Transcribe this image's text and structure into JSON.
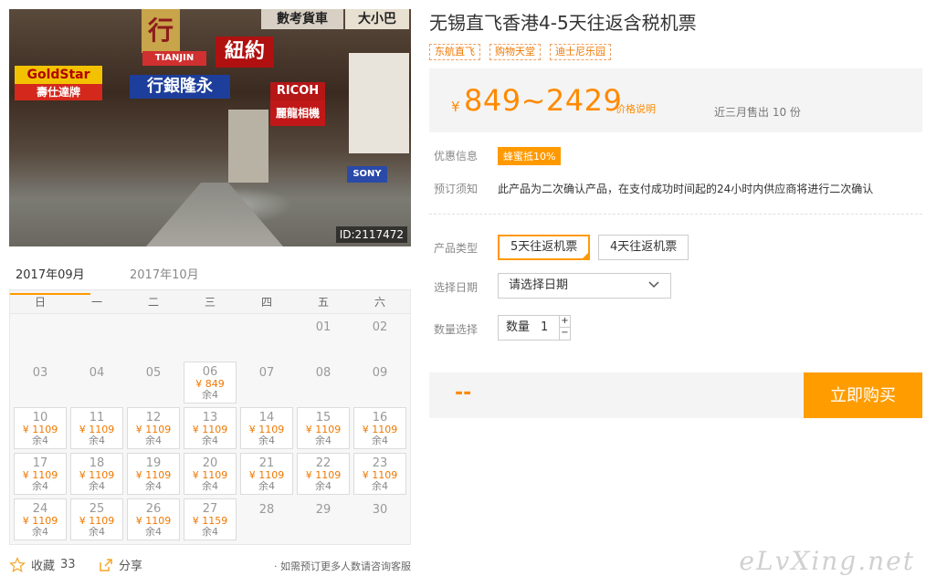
{
  "photo": {
    "id_label": "ID:2117472",
    "signs": [
      "行",
      "數考貨車",
      "大小巴",
      "GoldStar",
      "壽仕達牌",
      "行銀隆永",
      "紐約",
      "RICOH",
      "麗龍相機",
      "TIANJIN",
      "SONY"
    ]
  },
  "calendar": {
    "months": [
      "2017年09月",
      "2017年10月"
    ],
    "weekdays": [
      "日",
      "一",
      "二",
      "三",
      "四",
      "五",
      "六"
    ],
    "days": [
      {
        "d": ""
      },
      {
        "d": ""
      },
      {
        "d": ""
      },
      {
        "d": ""
      },
      {
        "d": ""
      },
      {
        "d": "01"
      },
      {
        "d": "02"
      },
      {
        "d": "03"
      },
      {
        "d": "04"
      },
      {
        "d": "05"
      },
      {
        "d": "06",
        "p": "¥ 849",
        "r": "余4"
      },
      {
        "d": "07"
      },
      {
        "d": "08"
      },
      {
        "d": "09"
      },
      {
        "d": "10",
        "p": "¥ 1109",
        "r": "余4"
      },
      {
        "d": "11",
        "p": "¥ 1109",
        "r": "余4"
      },
      {
        "d": "12",
        "p": "¥ 1109",
        "r": "余4"
      },
      {
        "d": "13",
        "p": "¥ 1109",
        "r": "余4"
      },
      {
        "d": "14",
        "p": "¥ 1109",
        "r": "余4"
      },
      {
        "d": "15",
        "p": "¥ 1109",
        "r": "余4"
      },
      {
        "d": "16",
        "p": "¥ 1109",
        "r": "余4"
      },
      {
        "d": "17",
        "p": "¥ 1109",
        "r": "余4"
      },
      {
        "d": "18",
        "p": "¥ 1109",
        "r": "余4"
      },
      {
        "d": "19",
        "p": "¥ 1109",
        "r": "余4"
      },
      {
        "d": "20",
        "p": "¥ 1109",
        "r": "余4"
      },
      {
        "d": "21",
        "p": "¥ 1109",
        "r": "余4"
      },
      {
        "d": "22",
        "p": "¥ 1109",
        "r": "余4"
      },
      {
        "d": "23",
        "p": "¥ 1109",
        "r": "余4"
      },
      {
        "d": "24",
        "p": "¥ 1109",
        "r": "余4"
      },
      {
        "d": "25",
        "p": "¥ 1109",
        "r": "余4"
      },
      {
        "d": "26",
        "p": "¥ 1109",
        "r": "余4"
      },
      {
        "d": "27",
        "p": "¥ 1159",
        "r": "余4"
      },
      {
        "d": "28"
      },
      {
        "d": "29"
      },
      {
        "d": "30"
      }
    ]
  },
  "footer": {
    "favorite_label": "收藏",
    "favorite_count": "33",
    "share_label": "分享",
    "note": "· 如需预订更多人数请咨询客服"
  },
  "product": {
    "title": "无锡直飞香港4-5天往返含税机票",
    "tags": [
      "东航直飞",
      "购物天堂",
      "迪士尼乐园"
    ],
    "currency": "¥",
    "price": "849~2429",
    "price_explain": "价格说明",
    "sold": "近三月售出 10 份",
    "promo_label": "优惠信息",
    "promo_badge": "蜂蜜抵10%",
    "notice_label": "预订须知",
    "notice_text": "此产品为二次确认产品，在支付成功时间起的24小时内供应商将进行二次确认",
    "type_label": "产品类型",
    "types": [
      "5天往返机票",
      "4天往返机票"
    ],
    "date_label": "选择日期",
    "date_placeholder": "请选择日期",
    "qty_label": "数量选择",
    "qty_prefix": "数量",
    "qty_value": "1",
    "qty_plus": "+",
    "qty_minus": "−",
    "total": "--",
    "buy_label": "立即购买"
  },
  "watermark": "eLvXing.net",
  "colors": {
    "accent": "#ff9900",
    "price": "#ff8a00"
  }
}
